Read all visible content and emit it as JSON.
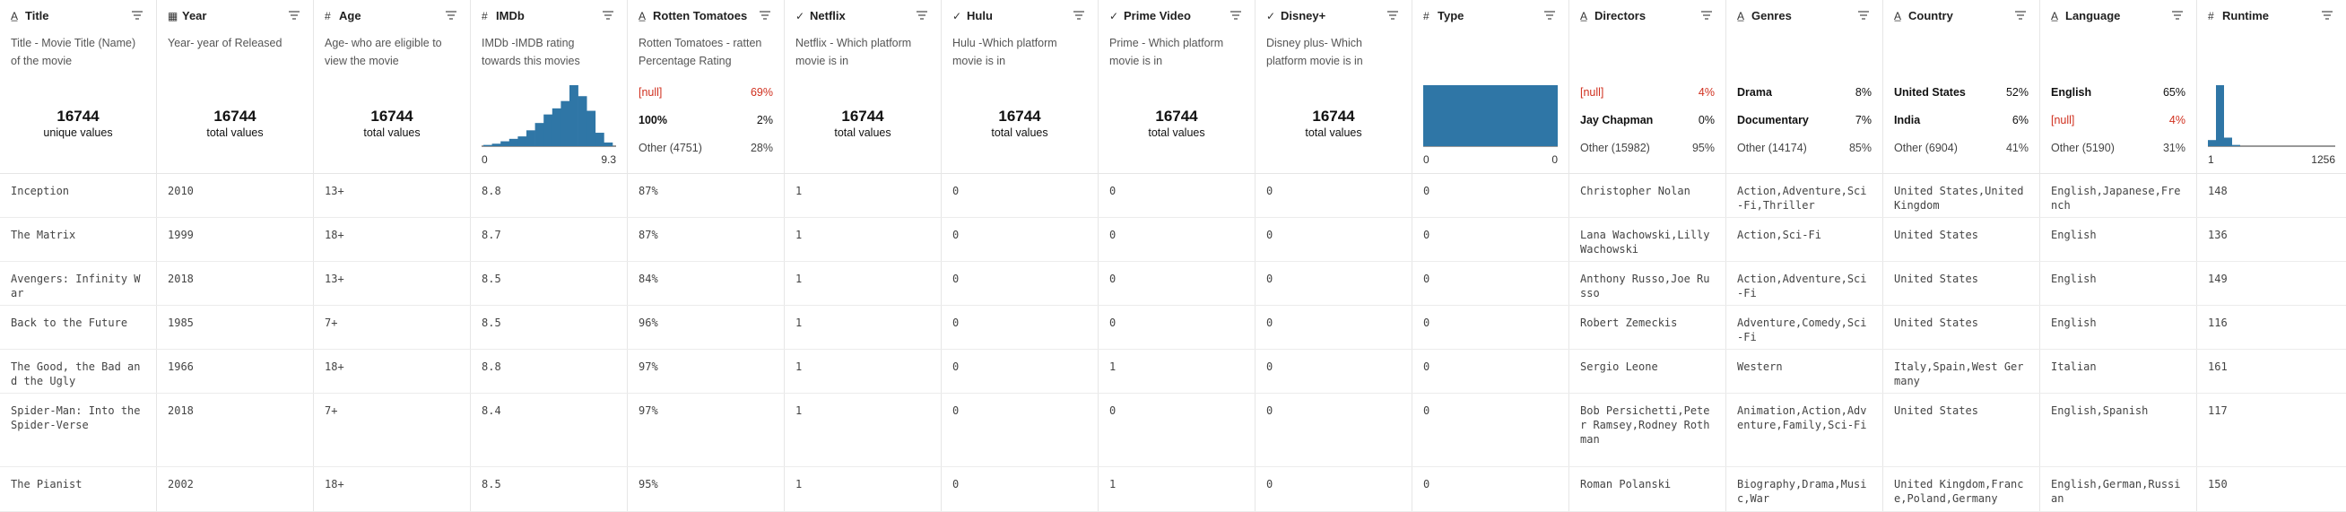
{
  "columns": [
    {
      "key": "title",
      "type_icon": "A̲",
      "name": "Title",
      "desc": "Title - Movie Title (Name) of the movie",
      "summary": {
        "kind": "count",
        "value": "16744",
        "label": "unique values"
      }
    },
    {
      "key": "year",
      "type_icon": "▦",
      "name": "Year",
      "desc": "Year- year of Released",
      "summary": {
        "kind": "count",
        "value": "16744",
        "label": "total values"
      }
    },
    {
      "key": "age",
      "type_icon": "#",
      "name": "Age",
      "desc": "Age- who are eligible to view the movie",
      "summary": {
        "kind": "count",
        "value": "16744",
        "label": "total values"
      }
    },
    {
      "key": "imdb",
      "type_icon": "#",
      "name": "IMDb",
      "desc": "IMDb -IMDB rating towards this movies",
      "summary": {
        "kind": "hist",
        "min_label": "0",
        "max_label": "9.3",
        "bins": [
          0.02,
          0.04,
          0.08,
          0.12,
          0.16,
          0.26,
          0.38,
          0.52,
          0.62,
          0.74,
          1.0,
          0.82,
          0.58,
          0.22,
          0.06
        ]
      }
    },
    {
      "key": "rt",
      "type_icon": "A̲",
      "name": "Rotten Tomatoes",
      "desc": "Rotten Tomatoes - ratten Percentage Rating",
      "summary": {
        "kind": "cats",
        "items": [
          {
            "label": "[null]",
            "pct": "69%",
            "style": "null"
          },
          {
            "label": "100%",
            "pct": "2%",
            "style": "bold"
          },
          {
            "label": "Other (4751)",
            "pct": "28%",
            "style": "other"
          }
        ]
      }
    },
    {
      "key": "netflix",
      "type_icon": "✓",
      "name": "Netflix",
      "desc": "Netflix - Which platform movie is in",
      "summary": {
        "kind": "count",
        "value": "16744",
        "label": "total values"
      }
    },
    {
      "key": "hulu",
      "type_icon": "✓",
      "name": "Hulu",
      "desc": "Hulu -Which platform movie is in",
      "summary": {
        "kind": "count",
        "value": "16744",
        "label": "total values"
      }
    },
    {
      "key": "prime",
      "type_icon": "✓",
      "name": "Prime Video",
      "desc": "Prime - Which platform movie is in",
      "summary": {
        "kind": "count",
        "value": "16744",
        "label": "total values"
      }
    },
    {
      "key": "disney",
      "type_icon": "✓",
      "name": "Disney+",
      "desc": "Disney plus- Which platform movie is in",
      "summary": {
        "kind": "count",
        "value": "16744",
        "label": "total values"
      }
    },
    {
      "key": "type",
      "type_icon": "#",
      "name": "Type",
      "desc": "",
      "summary": {
        "kind": "hist",
        "min_label": "0",
        "max_label": "0",
        "bins": [
          1.0
        ]
      }
    },
    {
      "key": "directors",
      "type_icon": "A̲",
      "name": "Directors",
      "desc": "",
      "summary": {
        "kind": "cats",
        "items": [
          {
            "label": "[null]",
            "pct": "4%",
            "style": "null"
          },
          {
            "label": "Jay Chapman",
            "pct": "0%",
            "style": "bold"
          },
          {
            "label": "Other (15982)",
            "pct": "95%",
            "style": "other"
          }
        ]
      }
    },
    {
      "key": "genres",
      "type_icon": "A̲",
      "name": "Genres",
      "desc": "",
      "summary": {
        "kind": "cats",
        "items": [
          {
            "label": "Drama",
            "pct": "8%",
            "style": "bold"
          },
          {
            "label": "Documentary",
            "pct": "7%",
            "style": "bold"
          },
          {
            "label": "Other (14174)",
            "pct": "85%",
            "style": "other"
          }
        ]
      }
    },
    {
      "key": "country",
      "type_icon": "A̲",
      "name": "Country",
      "desc": "",
      "summary": {
        "kind": "cats",
        "items": [
          {
            "label": "United States",
            "pct": "52%",
            "style": "bold"
          },
          {
            "label": "India",
            "pct": "6%",
            "style": "bold"
          },
          {
            "label": "Other (6904)",
            "pct": "41%",
            "style": "other"
          }
        ]
      }
    },
    {
      "key": "language",
      "type_icon": "A̲",
      "name": "Language",
      "desc": "",
      "summary": {
        "kind": "cats",
        "items": [
          {
            "label": "English",
            "pct": "65%",
            "style": "bold"
          },
          {
            "label": "[null]",
            "pct": "4%",
            "style": "null"
          },
          {
            "label": "Other (5190)",
            "pct": "31%",
            "style": "other"
          }
        ]
      }
    },
    {
      "key": "runtime",
      "type_icon": "#",
      "name": "Runtime",
      "desc": "",
      "summary": {
        "kind": "hist",
        "min_label": "1",
        "max_label": "1256",
        "bins": [
          0.1,
          1.0,
          0.14,
          0.02,
          0.0,
          0.0,
          0.0,
          0.0,
          0.0,
          0.0,
          0.0,
          0.0,
          0.0,
          0.0,
          0.0,
          0.0,
          0.0,
          0.0,
          0.0,
          0.0
        ]
      }
    }
  ],
  "rows": [
    {
      "title": "Inception",
      "year": "2010",
      "age": "13+",
      "imdb": "8.8",
      "rt": "87%",
      "netflix": "1",
      "hulu": "0",
      "prime": "0",
      "disney": "0",
      "type": "0",
      "directors": "Christopher Nolan",
      "genres": "Action,Adventure,Sci-Fi,Thriller",
      "country": "United States,United Kingdom",
      "language": "English,Japanese,French",
      "runtime": "148"
    },
    {
      "title": "The Matrix",
      "year": "1999",
      "age": "18+",
      "imdb": "8.7",
      "rt": "87%",
      "netflix": "1",
      "hulu": "0",
      "prime": "0",
      "disney": "0",
      "type": "0",
      "directors": "Lana Wachowski,Lilly Wachowski",
      "genres": "Action,Sci-Fi",
      "country": "United States",
      "language": "English",
      "runtime": "136"
    },
    {
      "title": "Avengers: Infinity War",
      "year": "2018",
      "age": "13+",
      "imdb": "8.5",
      "rt": "84%",
      "netflix": "1",
      "hulu": "0",
      "prime": "0",
      "disney": "0",
      "type": "0",
      "directors": "Anthony Russo,Joe Russo",
      "genres": "Action,Adventure,Sci-Fi",
      "country": "United States",
      "language": "English",
      "runtime": "149"
    },
    {
      "title": "Back to the Future",
      "year": "1985",
      "age": "7+",
      "imdb": "8.5",
      "rt": "96%",
      "netflix": "1",
      "hulu": "0",
      "prime": "0",
      "disney": "0",
      "type": "0",
      "directors": "Robert Zemeckis",
      "genres": "Adventure,Comedy,Sci-Fi",
      "country": "United States",
      "language": "English",
      "runtime": "116"
    },
    {
      "title": "The Good, the Bad and the Ugly",
      "year": "1966",
      "age": "18+",
      "imdb": "8.8",
      "rt": "97%",
      "netflix": "1",
      "hulu": "0",
      "prime": "1",
      "disney": "0",
      "type": "0",
      "directors": "Sergio Leone",
      "genres": "Western",
      "country": "Italy,Spain,West Germany",
      "language": "Italian",
      "runtime": "161"
    },
    {
      "title": "Spider-Man: Into the Spider-Verse",
      "year": "2018",
      "age": "7+",
      "imdb": "8.4",
      "rt": "97%",
      "netflix": "1",
      "hulu": "0",
      "prime": "0",
      "disney": "0",
      "type": "0",
      "directors": "Bob Persichetti,Peter Ramsey,Rodney Rothman",
      "genres": "Animation,Action,Adventure,Family,Sci-Fi",
      "country": "United States",
      "language": "English,Spanish",
      "runtime": "117"
    },
    {
      "title": "The Pianist",
      "year": "2002",
      "age": "18+",
      "imdb": "8.5",
      "rt": "95%",
      "netflix": "1",
      "hulu": "0",
      "prime": "1",
      "disney": "0",
      "type": "0",
      "directors": "Roman Polanski",
      "genres": "Biography,Drama,Music,War",
      "country": "United Kingdom,France,Poland,Germany",
      "language": "English,German,Russian",
      "runtime": "150"
    }
  ],
  "colors": {
    "bar": "#2f76a6",
    "null_text": "#d0301f"
  }
}
